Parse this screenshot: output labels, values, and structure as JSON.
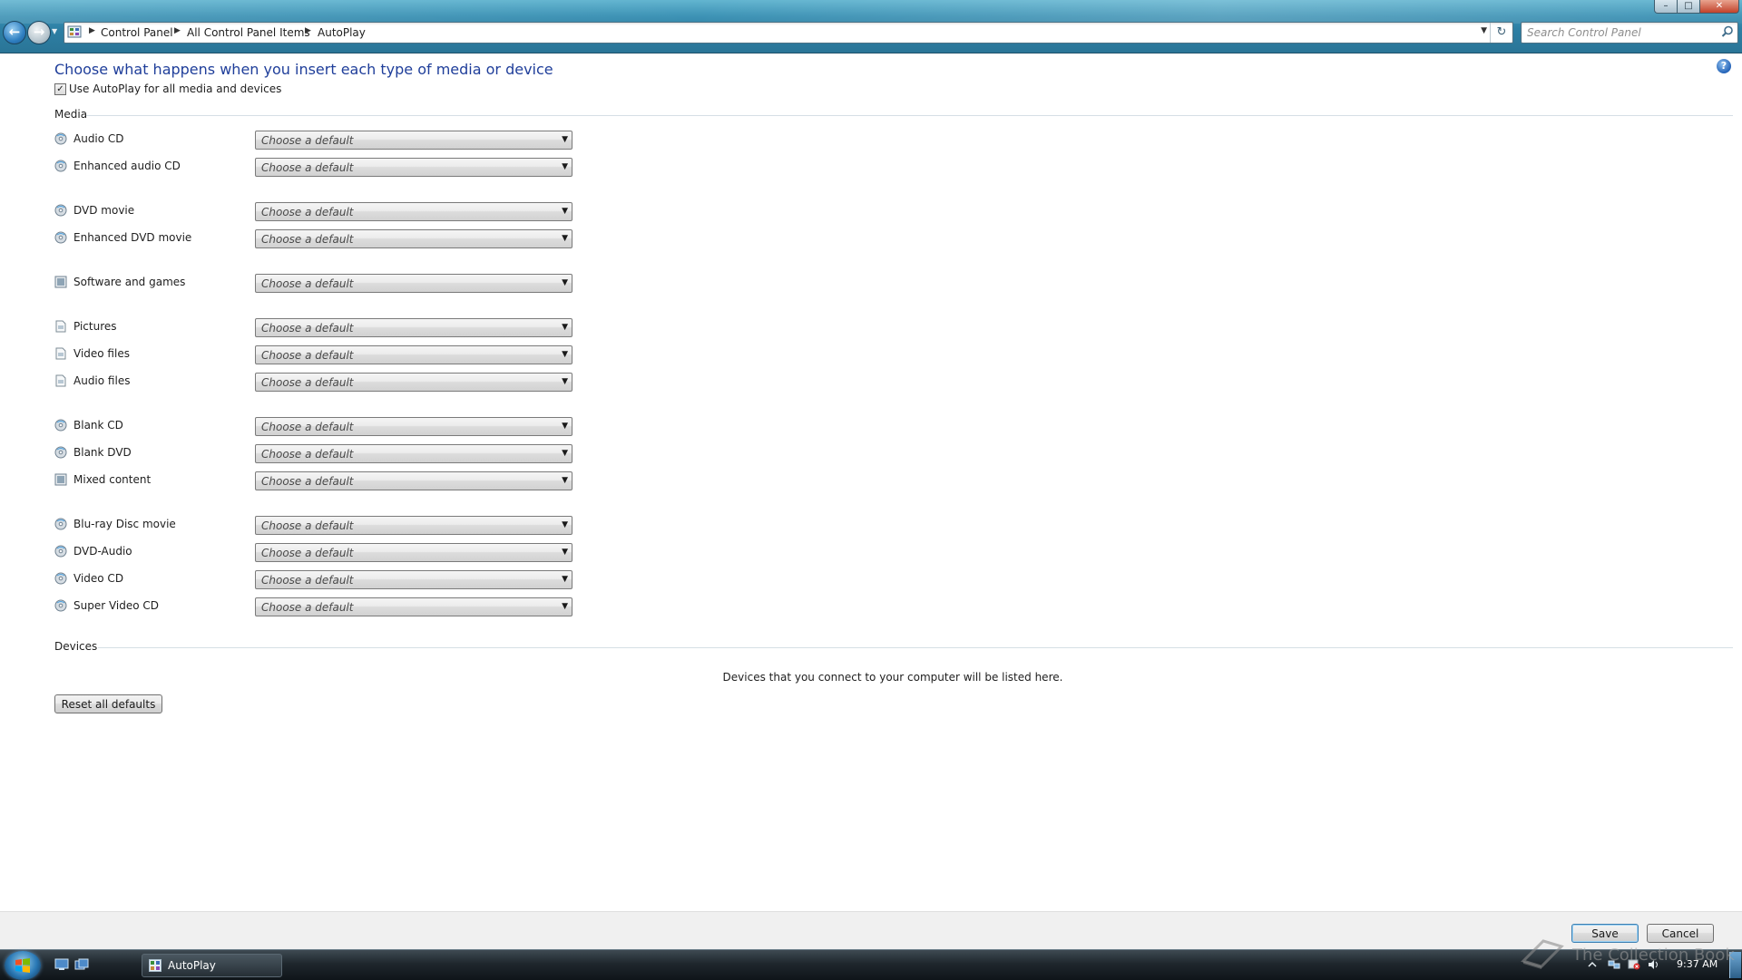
{
  "window": {
    "controls": {
      "minimize": "–",
      "maximize": "□",
      "close": "✕"
    }
  },
  "navigation": {
    "back_glyph": "←",
    "forward_glyph": "→",
    "breadcrumbs": [
      "Control Panel",
      "All Control Panel Items",
      "AutoPlay"
    ],
    "search_placeholder": "Search Control Panel",
    "refresh_glyph": "↻"
  },
  "page": {
    "title": "Choose what happens when you insert each type of media or device",
    "help_glyph": "?",
    "use_autoplay": {
      "label": "Use AutoPlay for all media and devices",
      "checked": true,
      "check_glyph": "✓"
    },
    "media_section_label": "Media",
    "select_placeholder": "Choose a default",
    "media_items": [
      {
        "label": "Audio CD",
        "icon": "audio-cd-icon"
      },
      {
        "label": "Enhanced audio CD",
        "icon": "enhanced-audio-cd-icon"
      },
      {
        "label": "DVD movie",
        "icon": "dvd-movie-icon"
      },
      {
        "label": "Enhanced DVD movie",
        "icon": "enhanced-dvd-movie-icon"
      },
      {
        "label": "Software and games",
        "icon": "software-games-icon"
      },
      {
        "label": "Pictures",
        "icon": "pictures-icon"
      },
      {
        "label": "Video files",
        "icon": "video-files-icon"
      },
      {
        "label": "Audio files",
        "icon": "audio-files-icon"
      },
      {
        "label": "Blank CD",
        "icon": "blank-cd-icon"
      },
      {
        "label": "Blank DVD",
        "icon": "blank-dvd-icon"
      },
      {
        "label": "Mixed content",
        "icon": "mixed-content-icon"
      },
      {
        "label": "Blu-ray Disc movie",
        "icon": "bluray-movie-icon"
      },
      {
        "label": "DVD-Audio",
        "icon": "dvd-audio-icon"
      },
      {
        "label": "Video CD",
        "icon": "video-cd-icon"
      },
      {
        "label": "Super Video CD",
        "icon": "super-video-cd-icon"
      }
    ],
    "devices_section_label": "Devices",
    "devices_empty_text": "Devices that you connect to your computer will be listed here.",
    "reset_button": "Reset all defaults"
  },
  "footer": {
    "save_button": "Save",
    "cancel_button": "Cancel"
  },
  "taskbar": {
    "active_task": "AutoPlay",
    "clock": "9:37 AM",
    "watermark": "The Collection Book"
  },
  "colors": {
    "title_blue": "#1f3e9a",
    "navbar": "#2d7fa4",
    "taskbar": "#1f272d"
  }
}
